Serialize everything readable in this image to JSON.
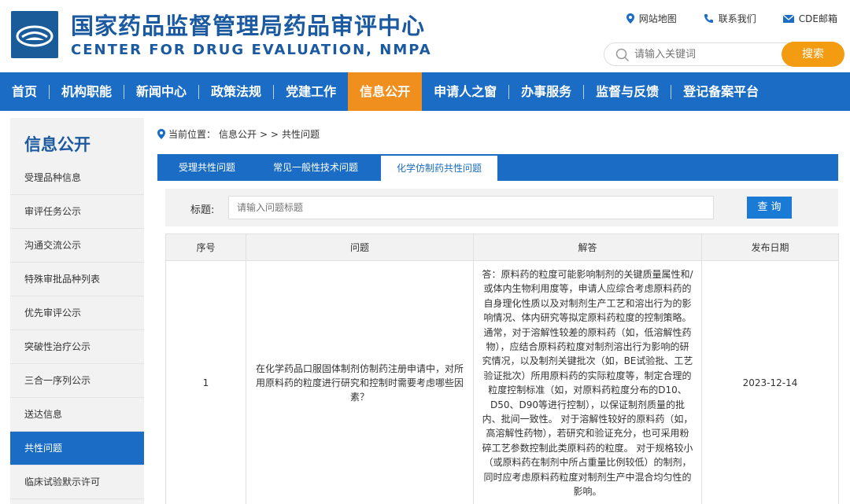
{
  "header": {
    "title_cn": "国家药品监督管理局药品审评中心",
    "title_en": "CENTER FOR DRUG EVALUATION, NMPA",
    "toplinks": [
      {
        "label": "网站地图",
        "icon": "location-pin-icon"
      },
      {
        "label": "联系我们",
        "icon": "phone-icon"
      },
      {
        "label": "CDE邮箱",
        "icon": "mail-icon"
      }
    ],
    "search_placeholder": "请输入关键词",
    "search_button": "搜索"
  },
  "nav": {
    "items": [
      {
        "label": "首页"
      },
      {
        "label": "机构职能"
      },
      {
        "label": "新闻中心"
      },
      {
        "label": "政策法规"
      },
      {
        "label": "党建工作"
      },
      {
        "label": "信息公开",
        "active": true
      },
      {
        "label": "申请人之窗"
      },
      {
        "label": "办事服务"
      },
      {
        "label": "监督与反馈"
      },
      {
        "label": "登记备案平台"
      }
    ]
  },
  "sidebar": {
    "title": "信息公开",
    "items": [
      {
        "label": "受理品种信息"
      },
      {
        "label": "审评任务公示"
      },
      {
        "label": "沟通交流公示"
      },
      {
        "label": "特殊审批品种列表"
      },
      {
        "label": "优先审评公示"
      },
      {
        "label": "突破性治疗公示"
      },
      {
        "label": "三合一序列公示"
      },
      {
        "label": "送达信息"
      },
      {
        "label": "共性问题",
        "active": true
      },
      {
        "label": "临床试验默示许可"
      }
    ]
  },
  "breadcrumb": {
    "prefix": "当前位置：",
    "path1": "信息公开",
    "sep": "> >",
    "path2": "共性问题"
  },
  "tabs": [
    {
      "label": "受理共性问题"
    },
    {
      "label": "常见一般性技术问题"
    },
    {
      "label": "化学仿制药共性问题",
      "active": true
    }
  ],
  "filter": {
    "label": "标题:",
    "placeholder": "请输入问题标题",
    "button": "查 询"
  },
  "table": {
    "headers": [
      "序号",
      "问题",
      "解答",
      "发布日期"
    ],
    "rows": [
      {
        "index": "1",
        "question": "在化学药品口服固体制剂仿制药注册申请中，对所用原料药的粒度进行研究和控制时需要考虑哪些因素？",
        "answer": "答：原料药的粒度可能影响制剂的关键质量属性和/或体内生物利用度等，申请人应综合考虑原料药的自身理化性质以及对制剂生产工艺和溶出行为的影响情况、体内研究等拟定原料药粒度的控制策略。 通常，对于溶解性较差的原料药（如，低溶解性药物），应结合原料药粒度对制剂溶出行为影响的研究情况，以及制剂关键批次（如，BE试验批、工艺验证批次）所用原料药的实际粒度等，制定合理的粒度控制标准（如，对原料药粒度分布的D10、D50、D90等进行控制），以保证制剂质量的批内、批间一致性。 对于溶解性较好的原料药（如，高溶解性药物），若研究和验证充分，也可采用粉碎工艺参数控制此类原料药的粒度。 对于规格较小（或原料药在制剂中所占重量比例较低）的制剂，同时应考虑原料药粒度对制剂生产中混合均匀性的影响。",
        "date": "2023-12-14"
      }
    ]
  },
  "colors": {
    "brand_blue": "#1a6cc4",
    "title_blue": "#1b5aa0",
    "accent_orange": "#f08f1e",
    "search_orange": "#f39c12"
  }
}
